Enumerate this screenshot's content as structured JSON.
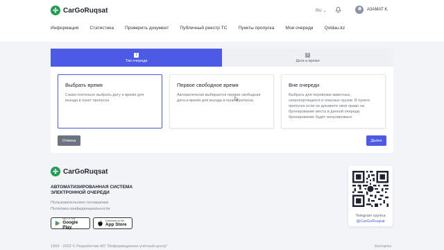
{
  "header": {
    "logo_text": "CarGoRuqsat",
    "language": "RU",
    "user_name": "АЗАМАТ К."
  },
  "nav": [
    {
      "label": "Информация"
    },
    {
      "label": "Статистика"
    },
    {
      "label": "Проверить документ"
    },
    {
      "label": "Публичный реестр ТС"
    },
    {
      "label": "Пункты пропуска"
    },
    {
      "label": "Мои очереди"
    },
    {
      "label": "Qoldau.kz"
    }
  ],
  "steps": [
    {
      "number": "1",
      "label": "Тип очереди",
      "active": true
    },
    {
      "number": "2",
      "label": "Дата и время",
      "active": false
    }
  ],
  "options": [
    {
      "title": "Выбрать время",
      "description": "Самостоятельно выбрать дату и время для въезда в пункт пропуска",
      "selected": true
    },
    {
      "title": "Первое свободное время",
      "description": "Автоматически выбирается первая свободная дата и время для въезда в пункт пропуска",
      "selected": false
    },
    {
      "title": "Вне очереди",
      "description": "Выбрать для перевозки животных, скоропортящихся и опасных грузов. В пункте пропуска если не докажете своё право на бронирование места в данной очереди, бронирование будет аннулировано",
      "selected": false
    }
  ],
  "actions": {
    "cancel_label": "Отмена",
    "next_label": "Далее"
  },
  "footer": {
    "logo_text": "CarGoRuqsat",
    "tagline": "АВТОМАТИЗИРОВАННАЯ СИСТЕМА ЭЛЕКТРОННОЙ ОЧЕРЕДИ",
    "links": [
      "Пользовательское соглашение",
      "Политика конфиденциальности"
    ],
    "google_play": {
      "small": "GET IT ON",
      "big": "Google Play"
    },
    "app_store": {
      "small": "Download on the",
      "big": "App Store"
    },
    "telegram_label": "Telegram группа",
    "telegram_handle": "@CarGoRuqsat",
    "copyright": "1993 - 2022 © Разработчик АО \"Информационно-учётный центр\"",
    "contacts": "Контакты"
  },
  "colors": {
    "accent": "#4d5ae5",
    "brand_green": "#1f9d55"
  }
}
